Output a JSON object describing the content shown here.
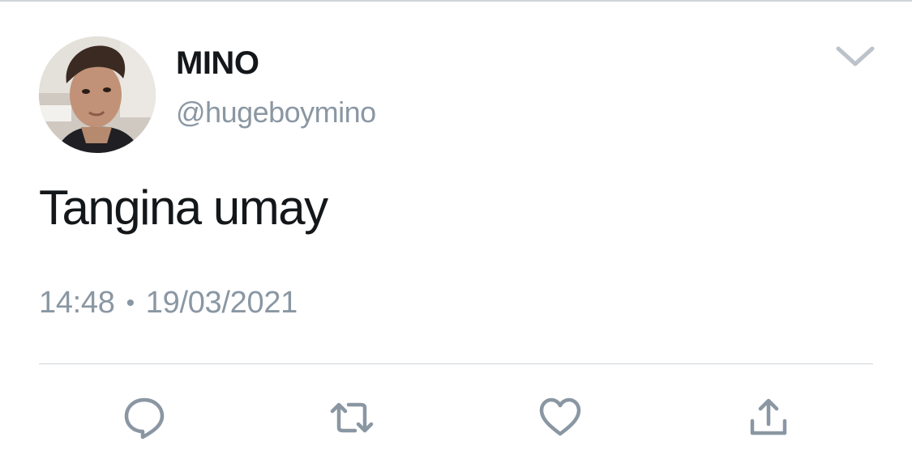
{
  "tweet": {
    "author": {
      "display_name": "MINO",
      "handle": "@hugeboymino"
    },
    "text": "Tangina umay",
    "time": "14:48",
    "separator": "•",
    "date": "19/03/2021"
  },
  "icons": {
    "menu": "chevron-down-icon",
    "reply": "reply-icon",
    "retweet": "retweet-icon",
    "like": "heart-icon",
    "share": "share-icon"
  },
  "colors": {
    "text_primary": "#14171a",
    "text_secondary": "#8a97a3",
    "icon_gray": "#8a97a3",
    "divider": "#cfd4d9"
  }
}
